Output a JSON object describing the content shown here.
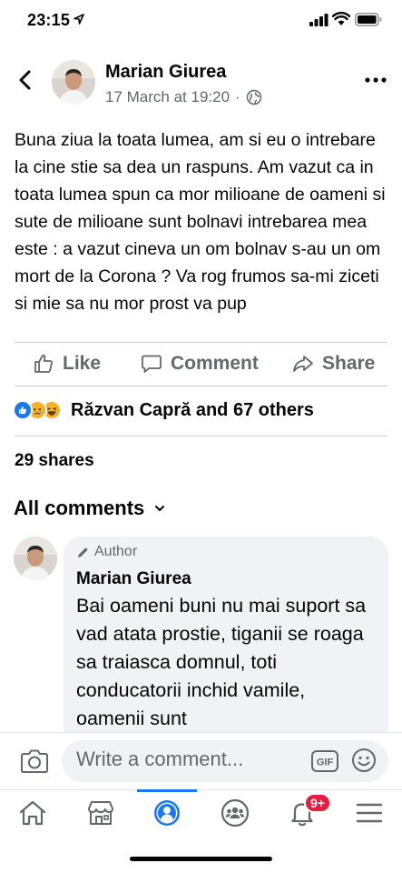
{
  "status_bar": {
    "time": "23:15"
  },
  "header": {
    "author": "Marian Giurea",
    "timestamp": "17 March at 19:20",
    "separator": "·",
    "privacy_icon": "globe-icon"
  },
  "post": {
    "text": "Buna ziua la toata lumea, am si eu o intrebare la cine stie sa dea un raspuns. Am vazut ca in toata lumea spun ca mor milioane de oameni si sute de milioane sunt bolnavi intrebarea mea este : a vazut cineva un om bolnav s-au un om mort de la Corona ? Va rog frumos sa-mi ziceti si mie sa nu mor prost va pup"
  },
  "actions": {
    "like": "Like",
    "comment": "Comment",
    "share": "Share"
  },
  "reactions": {
    "icons": [
      "like-reaction-icon",
      "sad-reaction-icon",
      "haha-reaction-icon"
    ],
    "summary": "Răzvan Capră and 67 others"
  },
  "shares": "29 shares",
  "comments_filter": "All comments",
  "comment": {
    "badge": "Author",
    "author": "Marian Giurea",
    "text": "Bai oameni buni nu mai suport sa vad atata prostie, tiganii se roaga sa traiasca domnul, toti conducatorii inchid vamile, oamenii sunt"
  },
  "composer": {
    "placeholder": "Write a comment...",
    "gif_label": "GIF"
  },
  "nav": {
    "items": [
      "home-icon",
      "marketplace-icon",
      "profile-icon",
      "groups-icon",
      "notifications-icon",
      "menu-icon"
    ],
    "notifications_badge": "9+"
  },
  "colors": {
    "accent": "#1877f2",
    "secondary_text": "#65676b",
    "bubble": "#f0f2f5",
    "badge": "#e41e3f"
  }
}
